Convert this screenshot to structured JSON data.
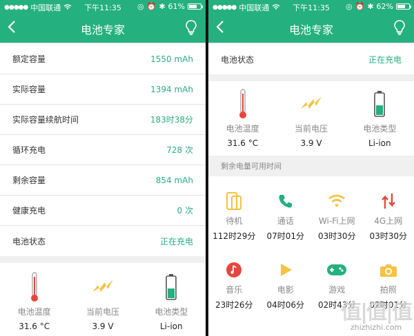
{
  "status": {
    "carrier": "中国联通",
    "time": "下午11:35",
    "left_battery": "61%",
    "right_battery": "62%"
  },
  "nav": {
    "title": "电池专家",
    "back_glyph": "<"
  },
  "left": {
    "rows": [
      {
        "label": "额定容量",
        "value": "1550 mAh"
      },
      {
        "label": "实际容量",
        "value": "1394 mAh"
      },
      {
        "label": "实际容量续航时间",
        "value": "183时38分"
      },
      {
        "label": "循环充电",
        "value": "728 次"
      },
      {
        "label": "剩余容量",
        "value": "854 mAh"
      },
      {
        "label": "健康充电",
        "value": "0 次"
      },
      {
        "label": "电池状态",
        "value": "正在充电"
      }
    ]
  },
  "info": [
    {
      "label": "电池温度",
      "value": "31.6 °C",
      "icon": "thermometer-icon"
    },
    {
      "label": "当前电压",
      "value": "3.9 V",
      "icon": "lightning-icon"
    },
    {
      "label": "电池类型",
      "value": "Li-ion",
      "icon": "battery-icon"
    }
  ],
  "right": {
    "status_row": {
      "label": "电池状态",
      "value": "正在充电"
    },
    "section_title": "剩余电量可用时间",
    "usage": [
      {
        "label": "待机",
        "value": "112时29分",
        "icon": "standby-icon"
      },
      {
        "label": "通话",
        "value": "07时01分",
        "icon": "phone-icon"
      },
      {
        "label": "Wi-Fi上网",
        "value": "03时30分",
        "icon": "wifi-icon"
      },
      {
        "label": "4G上网",
        "value": "03时30分",
        "icon": "data-arrows-icon"
      },
      {
        "label": "音乐",
        "value": "23时26分",
        "icon": "music-icon"
      },
      {
        "label": "电影",
        "value": "04时06分",
        "icon": "play-icon"
      },
      {
        "label": "游戏",
        "value": "02时43分",
        "icon": "gamepad-icon"
      },
      {
        "label": "拍照",
        "value": "02时01分",
        "icon": "camera-icon"
      }
    ]
  },
  "watermark": {
    "big": "值|值|值",
    "small": "zhizhizhi.com"
  },
  "colors": {
    "accent": "#25b07f",
    "warning": "#f5c242",
    "danger": "#e8453c"
  }
}
